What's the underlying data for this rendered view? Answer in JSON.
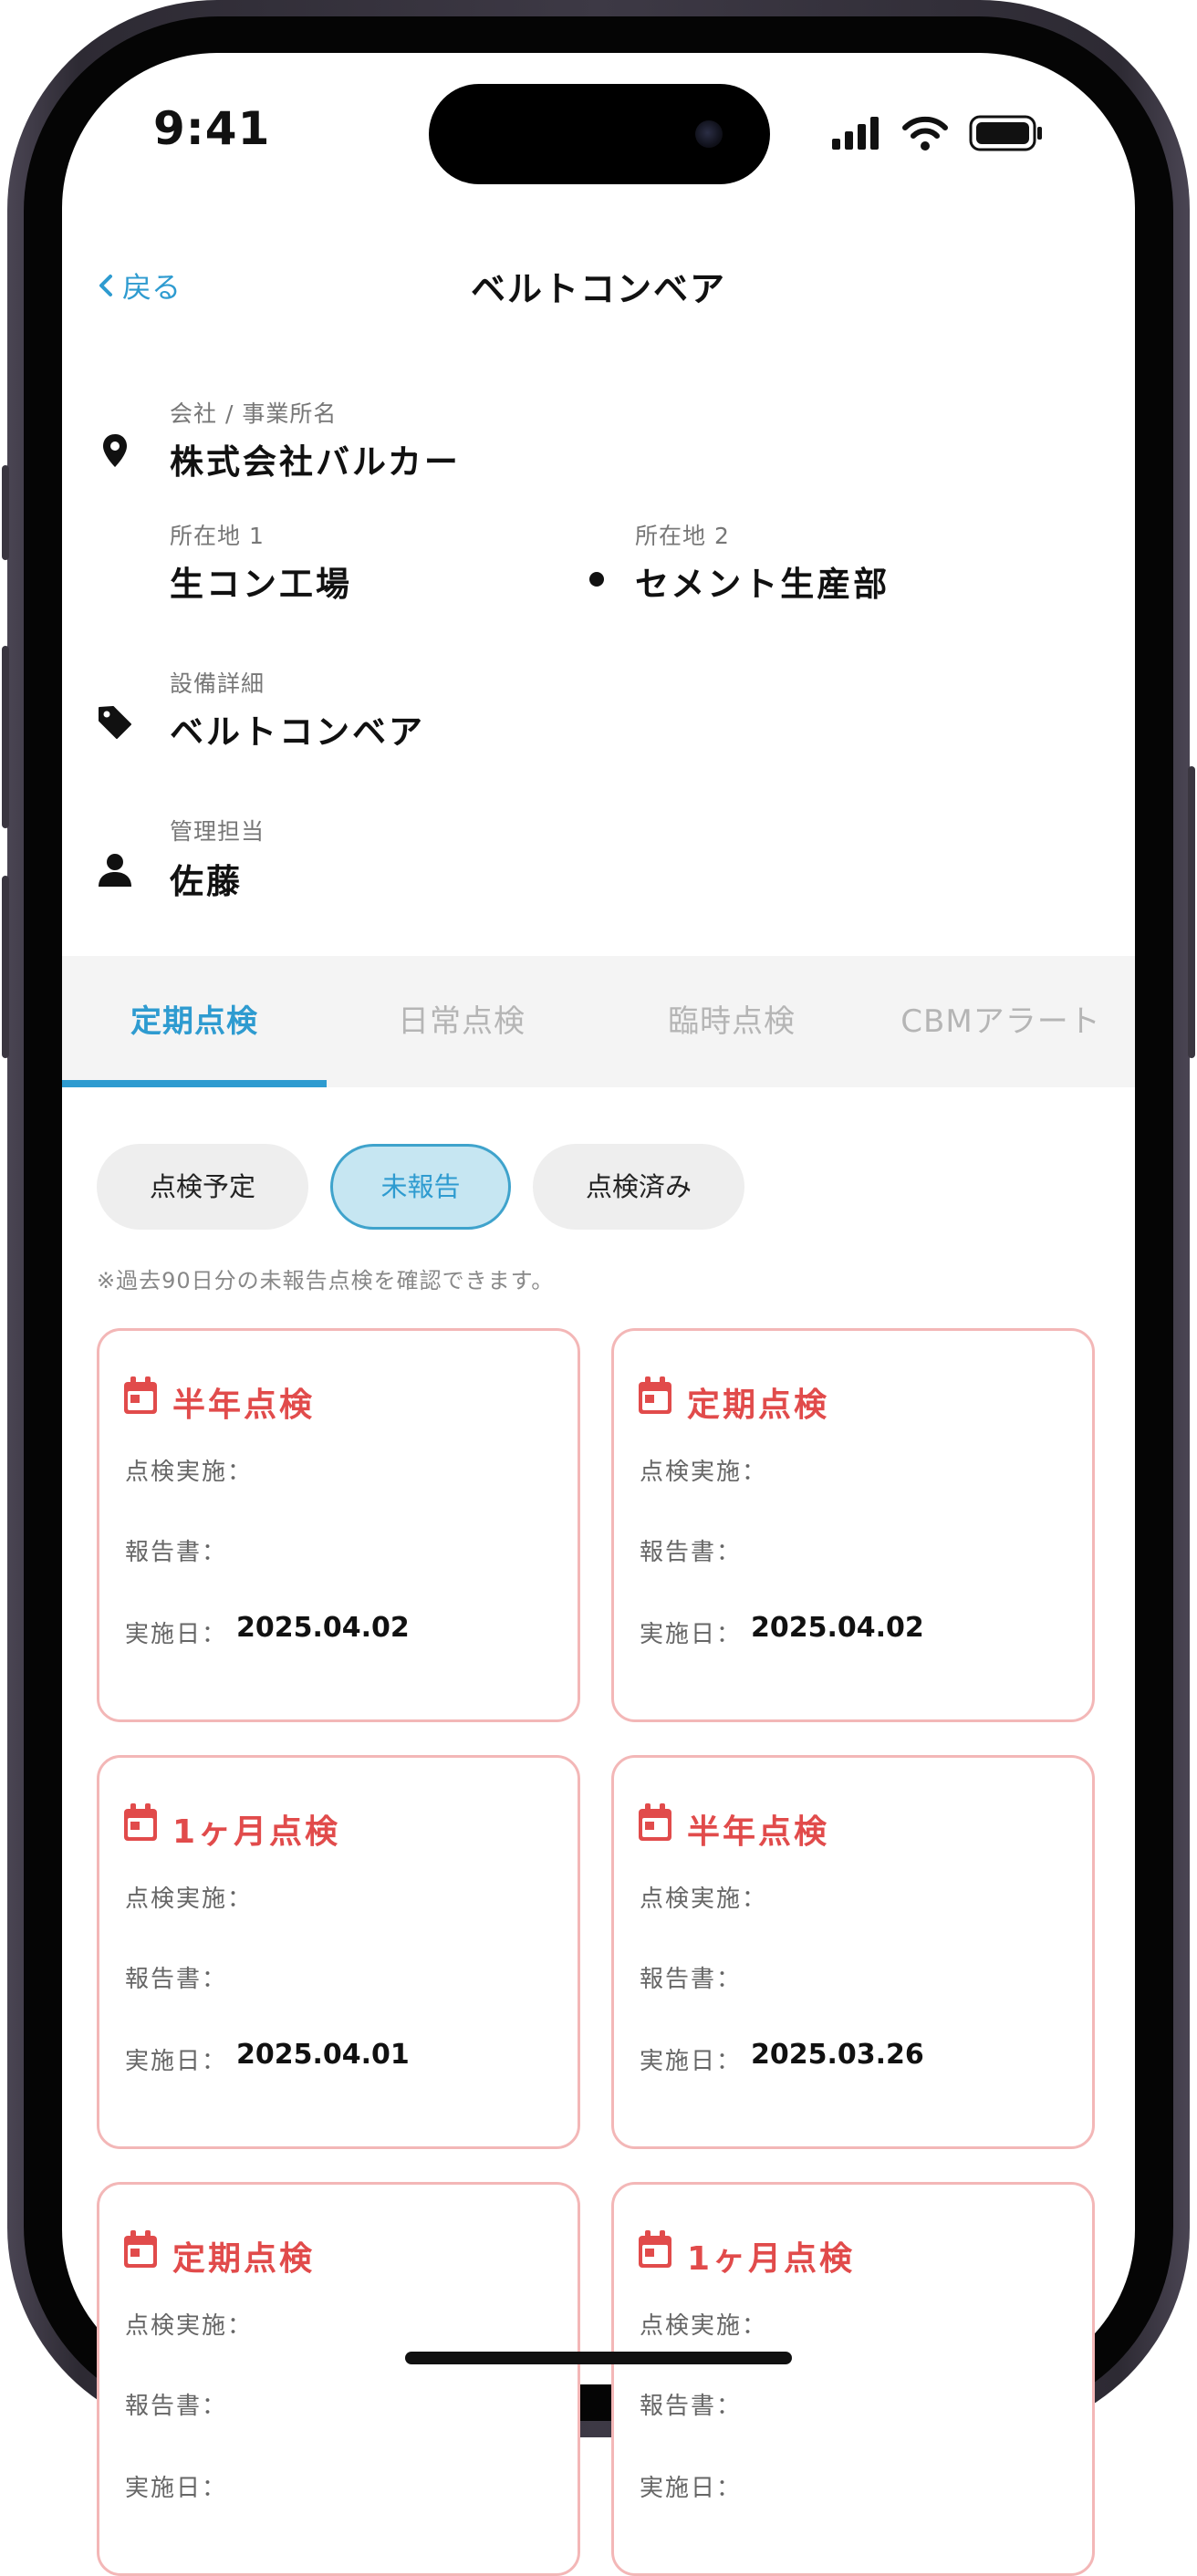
{
  "status_bar": {
    "time": "9:41",
    "icons": [
      "signal-icon",
      "wifi-icon",
      "battery-icon"
    ]
  },
  "nav": {
    "back_label": "戻る",
    "title": "ベルトコンベア"
  },
  "info": {
    "company_label": "会社 / 事業所名",
    "company_value": "株式会社バルカー",
    "location1_label": "所在地 1",
    "location1_value": "生コン工場",
    "location2_label": "所在地 2",
    "location2_value": "セメント生産部",
    "equipment_label": "設備詳細",
    "equipment_value": "ベルトコンベア",
    "manager_label": "管理担当",
    "manager_value": "佐藤"
  },
  "tabs": [
    {
      "label": "定期点検",
      "active": true
    },
    {
      "label": "日常点検",
      "active": false
    },
    {
      "label": "臨時点検",
      "active": false
    },
    {
      "label": "CBMアラート",
      "active": false
    }
  ],
  "filters": [
    {
      "label": "点検予定",
      "selected": false
    },
    {
      "label": "未報告",
      "selected": true
    },
    {
      "label": "点検済み",
      "selected": false
    }
  ],
  "note": "※過去90日分の未報告点検を確認できます。",
  "card_labels": {
    "performed": "点検実施：",
    "report": "報告書：",
    "date": "実施日："
  },
  "cards": [
    {
      "title": "半年点検",
      "performed": "",
      "report": "",
      "date": "2025.04.02"
    },
    {
      "title": "定期点検",
      "performed": "",
      "report": "",
      "date": "2025.04.02"
    },
    {
      "title": "1ヶ月点検",
      "performed": "",
      "report": "",
      "date": "2025.04.01"
    },
    {
      "title": "半年点検",
      "performed": "",
      "report": "",
      "date": "2025.03.26"
    },
    {
      "title": "定期点検",
      "performed": "",
      "report": "",
      "date": ""
    },
    {
      "title": "1ヶ月点検",
      "performed": "",
      "report": "",
      "date": ""
    }
  ],
  "colors": {
    "accent": "#2e9bd0",
    "alert": "#e14b4b",
    "card_border": "#f3b7b7"
  }
}
